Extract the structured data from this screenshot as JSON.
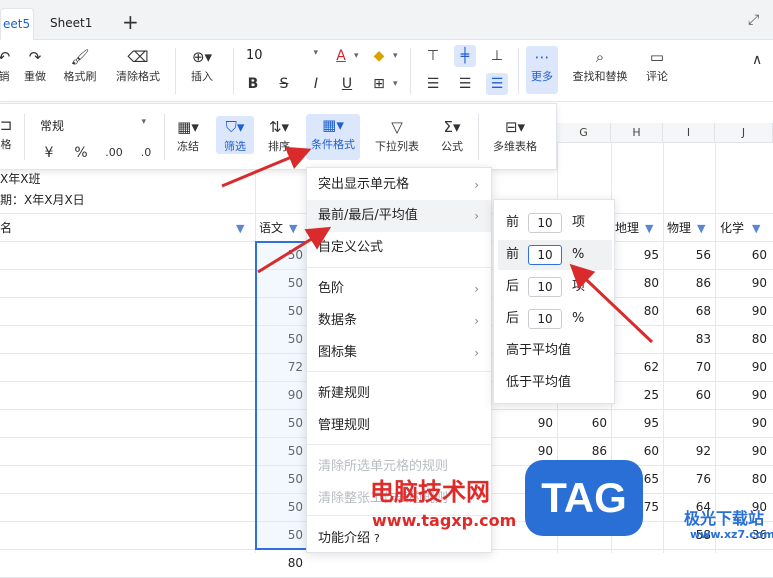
{
  "tabs": [
    {
      "label": "eet5",
      "active": true
    },
    {
      "label": "Sheet1",
      "active": false
    }
  ],
  "ribbon": {
    "undo_label": "销",
    "redo_label": "重做",
    "format_painter_label": "格式刷",
    "clear_format_label": "清除格式",
    "insert_label": "插入",
    "font_size": "10",
    "more_label": "更多",
    "find_replace_label": "查找和替换",
    "comment_label": "评论"
  },
  "toolbar2": {
    "prev_label": "格",
    "number_format": "常规",
    "currency_symbol": "¥",
    "percent_symbol": "%",
    "freeze_label": "冻结",
    "filter_label": "筛选",
    "sort_label": "排序",
    "cond_format_label": "条件格式",
    "dropdown_list_label": "下拉列表",
    "formula_label": "公式",
    "multi_table_label": "多维表格"
  },
  "sheet": {
    "title_line1": "X年X班",
    "title_line2": "期：X年X月X日",
    "col_letters": [
      "G",
      "H",
      "I",
      "J"
    ],
    "headers": {
      "name": "名",
      "chinese": "语文",
      "geography": "地理",
      "physics": "物理",
      "chemistry": "化学"
    },
    "chinese_col": [
      "50",
      "50",
      "50",
      "50",
      "72",
      "90",
      "50",
      "50",
      "50",
      "50",
      "50",
      "80"
    ],
    "rows": [
      {
        "f": "",
        "g": "",
        "h": "95",
        "i": "56",
        "j": "60"
      },
      {
        "f": "",
        "g": "",
        "h": "80",
        "i": "86",
        "j": "90"
      },
      {
        "f": "",
        "g": "",
        "h": "80",
        "i": "68",
        "j": "90"
      },
      {
        "f": "",
        "g": "",
        "h": "",
        "i": "83",
        "j": "80"
      },
      {
        "f": "",
        "g": "",
        "h": "62",
        "i": "70",
        "j": "90"
      },
      {
        "f": "",
        "g": "",
        "h": "25",
        "i": "60",
        "j": "90"
      },
      {
        "f": "90",
        "g": "60",
        "h": "95",
        "i": "",
        "j": "90"
      },
      {
        "f": "90",
        "g": "86",
        "h": "60",
        "i": "92",
        "j": "90"
      },
      {
        "f": "",
        "g": "",
        "h": "65",
        "i": "76",
        "j": "80"
      },
      {
        "f": "",
        "g": "",
        "h": "75",
        "i": "64",
        "j": "90"
      },
      {
        "f": "",
        "g": "",
        "h": "",
        "i": "58",
        "j": "36"
      }
    ]
  },
  "menu": {
    "items": [
      {
        "label": "突出显示单元格",
        "submenu": true,
        "disabled": false
      },
      {
        "label": "最前/最后/平均值",
        "submenu": true,
        "disabled": false
      },
      {
        "label": "自定义公式",
        "submenu": false,
        "disabled": false
      },
      {
        "label": "色阶",
        "submenu": true,
        "disabled": false
      },
      {
        "label": "数据条",
        "submenu": true,
        "disabled": false
      },
      {
        "label": "图标集",
        "submenu": true,
        "disabled": false
      },
      {
        "label": "新建规则",
        "submenu": false,
        "disabled": false
      },
      {
        "label": "管理规则",
        "submenu": false,
        "disabled": false
      },
      {
        "label": "清除所选单元格的规则",
        "submenu": false,
        "disabled": true
      },
      {
        "label": "清除整张工作表的规则",
        "submenu": false,
        "disabled": true
      },
      {
        "label": "功能介绍",
        "submenu": false,
        "disabled": false
      }
    ]
  },
  "submenu": {
    "items": [
      {
        "prefix": "前",
        "value": "10",
        "unit": "项"
      },
      {
        "prefix": "前",
        "value": "10",
        "unit": "%"
      },
      {
        "prefix": "后",
        "value": "10",
        "unit": "项"
      },
      {
        "prefix": "后",
        "value": "10",
        "unit": "%"
      }
    ],
    "above_avg": "高于平均值",
    "below_avg": "低于平均值"
  },
  "watermark": {
    "site_name": "电脑技术网",
    "url": "www.tagxp.com",
    "tag": "TAG",
    "right_text": "极光下载站",
    "right_url": "www.xz7.com"
  },
  "colors": {
    "accent": "#1f5fd1",
    "arrow": "#d92b2b",
    "watermark_red": "#e02a2a",
    "tag_blue": "#2a6fd6"
  }
}
